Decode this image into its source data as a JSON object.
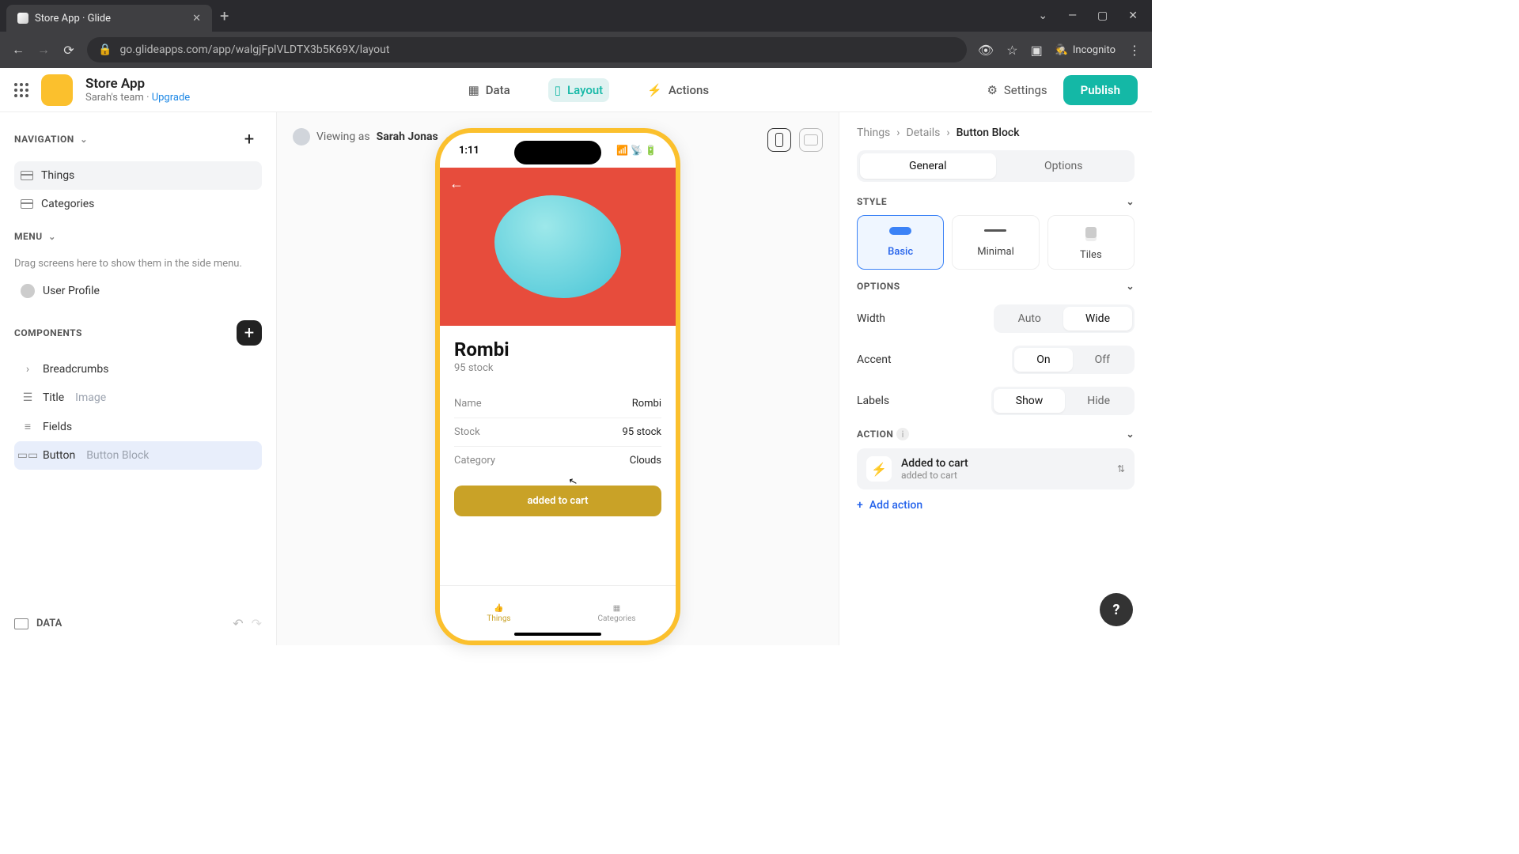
{
  "browser": {
    "tab_title": "Store App · Glide",
    "url": "go.glideapps.com/app/walgjFplVLDTX3b5K69X/layout",
    "incognito": "Incognito"
  },
  "app": {
    "title": "Store App",
    "team": "Sarah's team",
    "upgrade": "Upgrade",
    "center": {
      "data": "Data",
      "layout": "Layout",
      "actions": "Actions"
    },
    "settings": "Settings",
    "publish": "Publish"
  },
  "left": {
    "navigation": "NAVIGATION",
    "nav_items": [
      "Things",
      "Categories"
    ],
    "menu": "MENU",
    "menu_hint": "Drag screens here to show them in the side menu.",
    "user_profile": "User Profile",
    "components": "COMPONENTS",
    "comp": {
      "breadcrumbs": "Breadcrumbs",
      "title": "Title",
      "title_sub": "Image",
      "fields": "Fields",
      "button": "Button",
      "button_sub": "Button Block"
    },
    "data": "DATA"
  },
  "canvas": {
    "viewing_as_prefix": "Viewing as",
    "viewing_as_name": "Sarah Jonas"
  },
  "phone": {
    "time": "1:11",
    "title": "Rombi",
    "subtitle": "95 stock",
    "fields": [
      {
        "label": "Name",
        "value": "Rombi"
      },
      {
        "label": "Stock",
        "value": "95 stock"
      },
      {
        "label": "Category",
        "value": "Clouds"
      }
    ],
    "button": "added to cart",
    "tabs": [
      "Things",
      "Categories"
    ]
  },
  "right": {
    "crumb": [
      "Things",
      "Details",
      "Button Block"
    ],
    "tabs": {
      "general": "General",
      "options": "Options"
    },
    "style": "STYLE",
    "styles": [
      "Basic",
      "Minimal",
      "Tiles"
    ],
    "options": "OPTIONS",
    "width": "Width",
    "width_opts": [
      "Auto",
      "Wide"
    ],
    "accent": "Accent",
    "accent_opts": [
      "On",
      "Off"
    ],
    "labels": "Labels",
    "labels_opts": [
      "Show",
      "Hide"
    ],
    "action": "ACTION",
    "action_item": {
      "title": "Added to cart",
      "sub": "added to cart"
    },
    "add_action": "Add action"
  }
}
